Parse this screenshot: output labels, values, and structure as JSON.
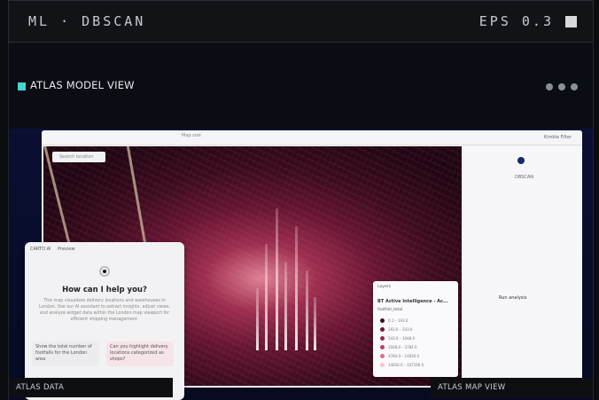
{
  "header": {
    "title": "ML · DBSCAN",
    "eps_label": "EPS 0.3"
  },
  "panel": {
    "title": "ATLAS MODEL VIEW"
  },
  "app": {
    "search_placeholder": "Search location",
    "zoom_label": "Map size",
    "kind_filter": "Kimble Filter",
    "node_label": "DBSCAN",
    "analysis_label": "Run analysis"
  },
  "chat": {
    "header": "CARTO AI",
    "tab": "Preview",
    "heading": "How can I help you?",
    "body": "This map visualizes delivery locations and warehouses in London. Use our AI assistant to extract insights, adjust views, and analyze widget data within the London map viewport for efficient shipping management.",
    "chip1": "Show the total number of footfalls for the London area",
    "chip2": "Can you highlight delivery locations categorized as shops?"
  },
  "legend": {
    "title": "Layers",
    "heading": "BT Active Intelligence - Ac...",
    "subheading": "footfall_total",
    "items": [
      "0.1 – 193.0",
      "193.0 – 543.0",
      "543.0 – 1048.0",
      "1048.0 – 3784.0",
      "3784.0 – 14830.0",
      "14830.0 – 107190.0"
    ],
    "colors": [
      "#3a0a22",
      "#6a1640",
      "#9b2456",
      "#c23a6b",
      "#e56c8e",
      "#f7c6cf"
    ]
  },
  "footer": {
    "left_label": "ATLAS DATA",
    "right_label": "ATLAS MAP VIEW"
  }
}
